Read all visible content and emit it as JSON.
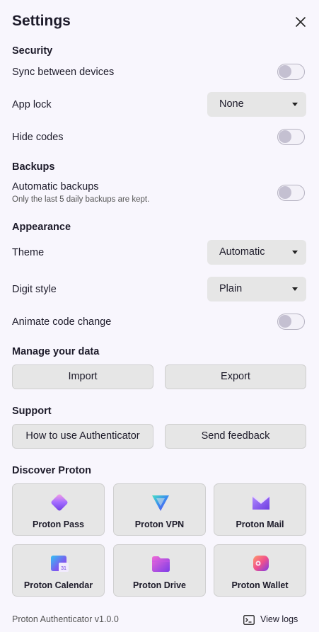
{
  "header": {
    "title": "Settings",
    "close_icon": "close-icon"
  },
  "security": {
    "heading": "Security",
    "sync_label": "Sync between devices",
    "app_lock_label": "App lock",
    "app_lock_value": "None",
    "hide_codes_label": "Hide codes"
  },
  "backups": {
    "heading": "Backups",
    "auto_label": "Automatic backups",
    "auto_sub": "Only the last 5 daily backups are kept."
  },
  "appearance": {
    "heading": "Appearance",
    "theme_label": "Theme",
    "theme_value": "Automatic",
    "digit_label": "Digit style",
    "digit_value": "Plain",
    "animate_label": "Animate code change"
  },
  "toggles": {
    "sync": false,
    "hide_codes": false,
    "auto_backups": false,
    "animate": false
  },
  "data": {
    "heading": "Manage your data",
    "import_label": "Import",
    "export_label": "Export"
  },
  "support": {
    "heading": "Support",
    "howto_label": "How to use Authenticator",
    "feedback_label": "Send feedback"
  },
  "discover": {
    "heading": "Discover Proton",
    "apps": [
      {
        "label": "Proton Pass",
        "icon": "proton-pass-icon"
      },
      {
        "label": "Proton VPN",
        "icon": "proton-vpn-icon"
      },
      {
        "label": "Proton Mail",
        "icon": "proton-mail-icon"
      },
      {
        "label": "Proton Calendar",
        "icon": "proton-calendar-icon",
        "icon_text": "31"
      },
      {
        "label": "Proton Drive",
        "icon": "proton-drive-icon"
      },
      {
        "label": "Proton Wallet",
        "icon": "proton-wallet-icon"
      }
    ]
  },
  "footer": {
    "version": "Proton Authenticator v1.0.0",
    "view_logs_label": "View logs",
    "view_logs_icon": "terminal-icon"
  },
  "colors": {
    "background": "#f8f6fd",
    "control": "#e6e6e6",
    "toggle_knob": "#c4c0d1"
  }
}
